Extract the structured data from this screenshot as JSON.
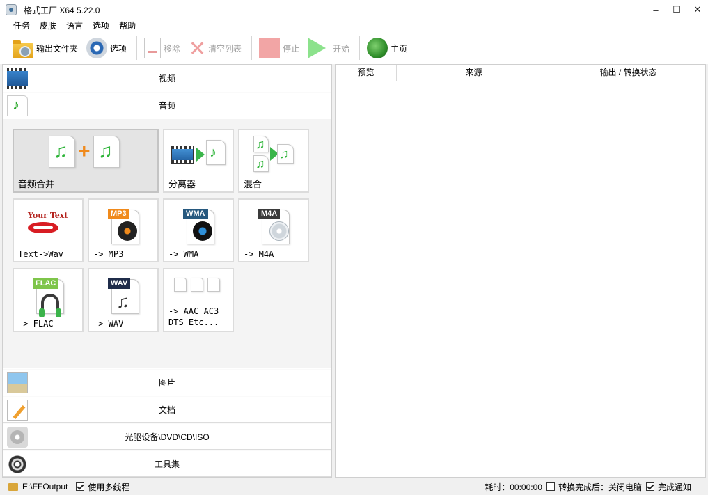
{
  "window": {
    "title": "格式工厂 X64 5.22.0",
    "minimize": "–",
    "maximize": "☐",
    "close": "✕"
  },
  "menu": [
    "任务",
    "皮肤",
    "语言",
    "选项",
    "帮助"
  ],
  "toolbar": {
    "output_folder": "输出文件夹",
    "options": "选项",
    "remove": "移除",
    "clear_list": "清空列表",
    "stop": "停止",
    "start": "开始",
    "home": "主页"
  },
  "categories": {
    "video": "视频",
    "audio": "音频",
    "picture": "图片",
    "document": "文档",
    "disc": "光驱设备\\DVD\\CD\\ISO",
    "tools": "工具集"
  },
  "audio_tiles": {
    "merge": "音频合并",
    "splitter": "分离器",
    "mix": "混合",
    "text_wav": "Text->Wav",
    "mp3": "-> MP3",
    "wma": "-> WMA",
    "m4a": "-> M4A",
    "flac": "-> FLAC",
    "wav": "-> WAV",
    "other": "-> AAC AC3\nDTS Etc...",
    "your_text": "Your Text",
    "badge_mp3": "MP3",
    "badge_wma": "WMA",
    "badge_m4a": "M4A",
    "badge_flac": "FLAC",
    "badge_wav": "WAV"
  },
  "task_table": {
    "columns": [
      "预览",
      "来源",
      "输出 / 转换状态"
    ],
    "rows": []
  },
  "statusbar": {
    "output_path": "E:\\FFOutput",
    "multithread_label": "使用多线程",
    "multithread_checked": true,
    "elapsed": "耗时：00:00:00",
    "after_convert_label": "转换完成后：关闭电脑",
    "after_convert_checked": false,
    "notify_label": "完成通知",
    "notify_checked": true
  },
  "colors": {
    "badge_mp3": "#f08a1c",
    "badge_wma": "#27597f",
    "badge_m4a": "#3b3b3b",
    "badge_flac": "#7ec54a",
    "badge_wav": "#1f2c4a"
  }
}
